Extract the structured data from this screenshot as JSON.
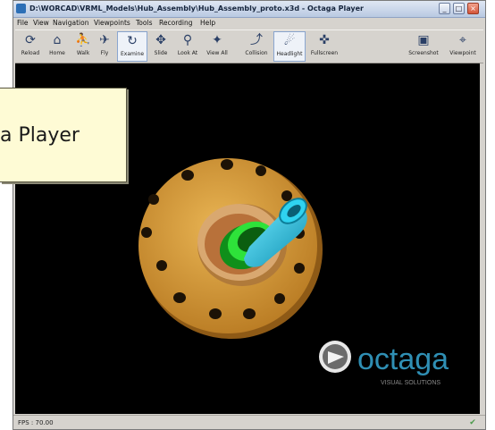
{
  "window": {
    "title": "D:\\WORCAD\\VRML_Models\\Hub_Assembly\\Hub_Assembly_proto.x3d - Octaga Player",
    "min_glyph": "_",
    "max_glyph": "□",
    "close_glyph": "×"
  },
  "menu": [
    "File",
    "View",
    "Navigation",
    "Viewpoints",
    "Tools",
    "Recording",
    "Help"
  ],
  "toolbar": [
    {
      "label": "Reload",
      "icon": "reload-icon"
    },
    {
      "label": "Home",
      "icon": "home-icon"
    },
    {
      "label": "Walk",
      "icon": "walk-icon"
    },
    {
      "label": "Fly",
      "icon": "fly-icon"
    },
    {
      "label": "Examine",
      "icon": "examine-icon",
      "active": true
    },
    {
      "label": "Slide",
      "icon": "slide-icon"
    },
    {
      "label": "Look At",
      "icon": "look-at-icon"
    },
    {
      "label": "View All",
      "icon": "view-all-icon"
    },
    {
      "label": "Collision",
      "icon": "collision-icon"
    },
    {
      "label": "Headlight",
      "icon": "headlight-icon",
      "active": true
    },
    {
      "label": "Fullscreen",
      "icon": "fullscreen-icon"
    },
    {
      "label": "Screenshot",
      "icon": "screenshot-icon"
    },
    {
      "label": "Viewpoint",
      "icon": "viewpoint-icon"
    }
  ],
  "logo": {
    "name": "octaga",
    "tagline": "VISUAL SOLUTIONS"
  },
  "status": {
    "fps": "FPS : 70.00"
  },
  "callout": {
    "text": "a Player"
  },
  "colors": {
    "viewport_bg": "#000000",
    "flange": "#d59a3a",
    "shaft": "#1ec7e6",
    "ring": "#2ee23a",
    "logo_text": "#2f8fb4",
    "callout_bg": "#fefbd5"
  }
}
